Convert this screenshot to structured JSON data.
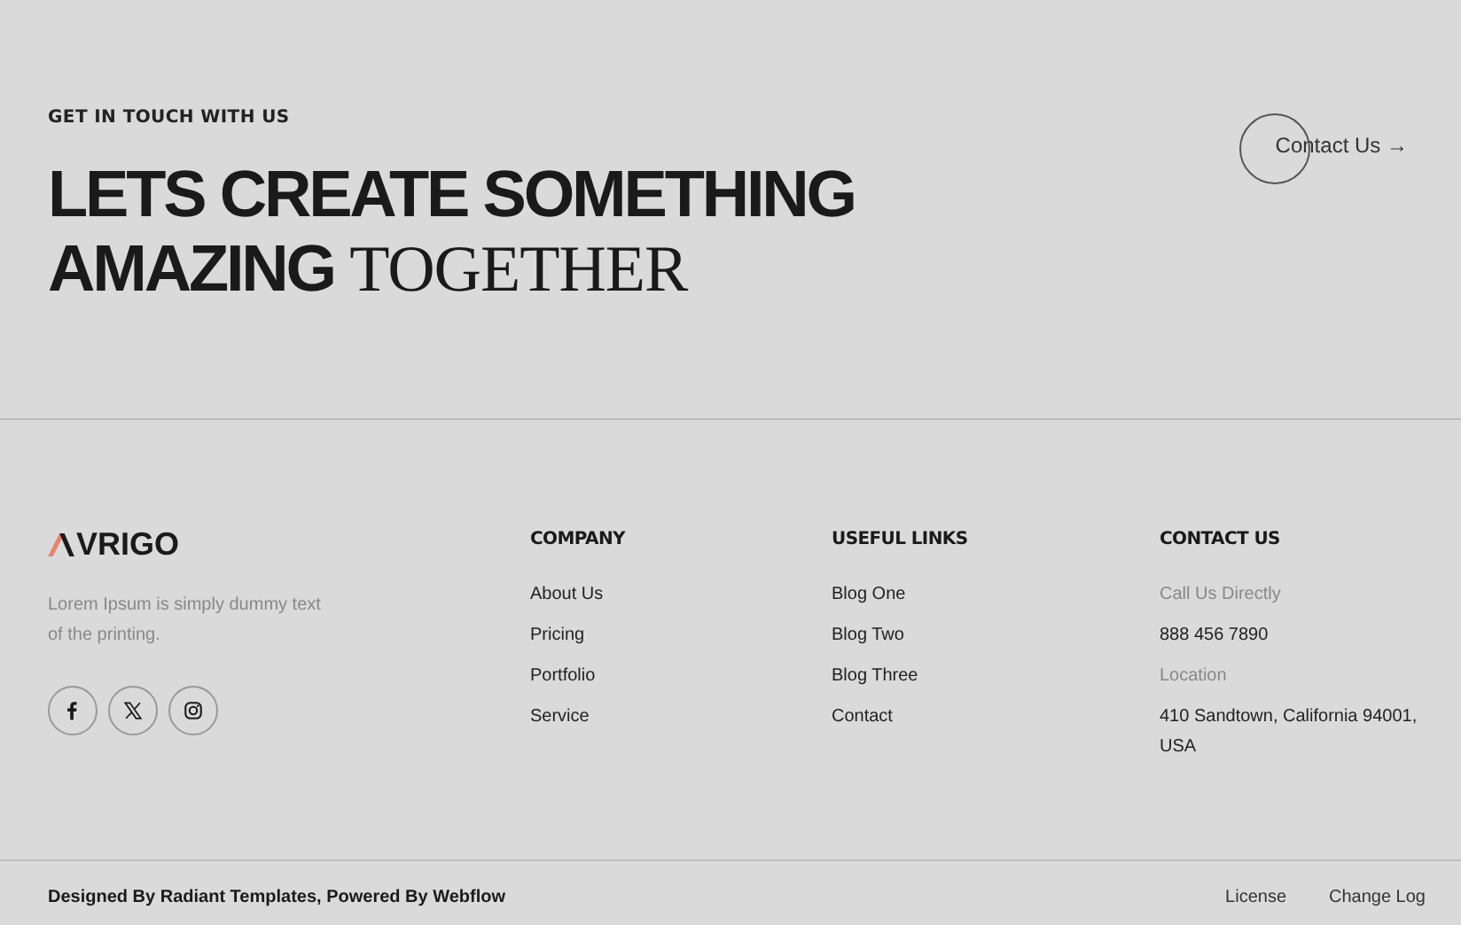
{
  "hero": {
    "eyebrow": "GET IN TOUCH WITH US",
    "headline_line1": "LETS CREATE SOMETHING",
    "headline_bold": "AMAZING",
    "headline_serif": "TOGETHER",
    "contact_link": {
      "label": "Contact Us",
      "arrow": "→"
    }
  },
  "brand": {
    "name": "VRIGO",
    "tagline": "Lorem Ipsum is simply dummy text of the printing."
  },
  "social": [
    {
      "kind": "facebook"
    },
    {
      "kind": "x"
    },
    {
      "kind": "instagram"
    }
  ],
  "columns": [
    {
      "title": "COMPANY",
      "items": [
        {
          "kind": "link",
          "text": "About Us"
        },
        {
          "kind": "link",
          "text": "Pricing"
        },
        {
          "kind": "link",
          "text": "Portfolio"
        },
        {
          "kind": "link",
          "text": "Service"
        }
      ]
    },
    {
      "title": "USEFUL LINKS",
      "items": [
        {
          "kind": "link",
          "text": "Blog One"
        },
        {
          "kind": "link",
          "text": "Blog Two"
        },
        {
          "kind": "link",
          "text": "Blog Three"
        },
        {
          "kind": "link",
          "text": "Contact"
        }
      ]
    },
    {
      "title": "CONTACT US",
      "items": [
        {
          "kind": "label",
          "text": "Call Us Directly"
        },
        {
          "kind": "value",
          "text": "888 456 7890"
        },
        {
          "kind": "label",
          "text": "Location"
        },
        {
          "kind": "value",
          "text": "410 Sandtown, California 94001, USA"
        }
      ]
    }
  ],
  "bottom_bar": {
    "credit": "Designed By Radiant Templates, Powered By Webflow",
    "links": [
      "License",
      "Change Log"
    ]
  }
}
